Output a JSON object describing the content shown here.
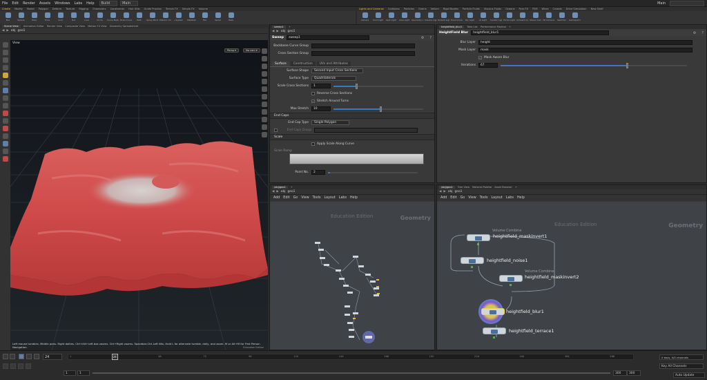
{
  "menubar": {
    "items": [
      "File",
      "Edit",
      "Render",
      "Assets",
      "Windows",
      "Labs",
      "Help"
    ],
    "build": "Build",
    "desktop": "Main",
    "user": "Main"
  },
  "shelf_left": {
    "tabs": [
      "Create",
      "Modify",
      "Model",
      "Polygon",
      "Deform",
      "Texture",
      "Rigging",
      "Characters",
      "Constraints",
      "Hair Utils",
      "Guide Process",
      "Terrain FX",
      "Simple FX",
      "Volume"
    ],
    "tools": [
      "Box",
      "Sphere",
      "Tube",
      "Torus",
      "Grid",
      "Null",
      "Line",
      "Circle",
      "Curve Bezier",
      "Draw Curve",
      "Path",
      "Spray Paint",
      "Platonic Solids",
      "L-System",
      "Metaball",
      "File",
      "Spiral",
      "Helix"
    ]
  },
  "shelf_right": {
    "tabs": [
      "Lights and Cameras",
      "Collisions",
      "Particles",
      "Grains",
      "Vellum",
      "Rigid Bodies",
      "Particle Fluids",
      "Viscous Fluids",
      "Oceans",
      "Pyro FX",
      "FEM",
      "Wires",
      "Crowds",
      "Drive Simulation",
      "New Shelf"
    ],
    "tools": [
      "Camera",
      "Point Light",
      "Spot Light",
      "Area Light",
      "Geometry Light",
      "Volume Light",
      "Distant Light",
      "Environment Light",
      "Sky Light",
      "GI Light",
      "Caustic Light",
      "Portal Light",
      "Ambient Light",
      "Stereo Camera",
      "VR Camera",
      "Switcher",
      "Gamepad Camera"
    ]
  },
  "viewport": {
    "tabs": [
      "Scene View",
      "Animation Editor",
      "Render View",
      "Composite View",
      "Motion FX View",
      "Geometry Spreadsheet"
    ],
    "path": {
      "obj": "obj",
      "node": "geo1"
    },
    "title": "View",
    "persp": "Persp ▾",
    "cam": "No cam ▾",
    "hint": "Left mouse tumbles. Middle pans. Right dollies. Ctrl+Alt+Left box zooms. Ctrl+Right zooms. Spacebar-Ctrl-Left tilts. Hold L for alternate tumble, dolly, and zoom.    M or Alt+M for First Person Navigation.",
    "tag": "Education Edition"
  },
  "params_sweep": {
    "tabs": [
      "sweep1",
      "+"
    ],
    "path": {
      "obj": "obj",
      "node": "geo1"
    },
    "node_type": "Sweep",
    "node_name": "sweep1",
    "backbone_label": "Backbone Curve Group",
    "cross_label": "Cross Section Group",
    "ptabs": [
      "Surface",
      "Construction",
      "UVs and Attributes"
    ],
    "surface_shape_label": "Surface Shape",
    "surface_shape": "Second Input Cross Sections",
    "surface_type_label": "Surface Type",
    "surface_type": "Quadrilaterals",
    "scale_label": "Scale Cross Sections",
    "scale_value": "1",
    "reverse_label": "Reverse Cross Sections",
    "stretch_label": "Stretch Around Turns",
    "max_stretch_label": "Max Stretch",
    "max_stretch_value": "10",
    "end_caps_section": "End Caps",
    "end_cap_type_label": "End Cap Type",
    "end_cap_type": "Single Polygon",
    "end_caps_group_label": "End Caps Group",
    "scale_section": "Scale",
    "apply_scale_label": "Apply Scale Along Curve",
    "scale_ramp_label": "Scale Ramp",
    "point_no_label": "Point No.",
    "point_no_value": "2",
    "position_label": "Position"
  },
  "params_blur": {
    "tabs": [
      "heightfield_blur1",
      "Take List",
      "Performance Monitor",
      "+"
    ],
    "node_type": "HeightField Blur",
    "node_name": "heightfield_blur1",
    "blur_layer_label": "Blur Layer",
    "blur_layer": "height",
    "mask_layer_label": "Mask Layer",
    "mask_layer": "mask",
    "mask_blur_label": "Mask Aware Blur",
    "iterations_label": "Iterations",
    "iterations_value": "67"
  },
  "net_left": {
    "tabs": [
      "/obj/geo1",
      "+"
    ],
    "path": {
      "obj": "obj",
      "node": "geo1"
    },
    "menu": [
      "Add",
      "Edit",
      "Go",
      "View",
      "Tools",
      "Layout",
      "Labs",
      "Help"
    ],
    "edition": "Education Edition",
    "context": "Geometry"
  },
  "net_right": {
    "tabs": [
      "/obj/geo1",
      "Tree View",
      "Material Palette",
      "Asset Browser",
      "+"
    ],
    "path": {
      "obj": "obj",
      "node": "geo1"
    },
    "menu": [
      "Add",
      "Edit",
      "Go",
      "View",
      "Tools",
      "Layout",
      "Labs",
      "Help"
    ],
    "edition": "Education Edition",
    "context": "Geometry",
    "nodes": [
      {
        "name": "heightfield_maskinvert1",
        "sub": "Volume Combine"
      },
      {
        "name": "heightfield_noise1",
        "sub": ""
      },
      {
        "name": "heightfield_maskinvert2",
        "sub": "Volume Combine"
      },
      {
        "name": "heightfield_blur1",
        "sub": ""
      },
      {
        "name": "heightfield_terrace1",
        "sub": ""
      }
    ]
  },
  "timeline": {
    "frame": "24",
    "current": "24",
    "start": "1",
    "start2": "1",
    "end": "300",
    "end2": "300",
    "ticks": [
      "1",
      "24",
      "48",
      "72",
      "96",
      "120",
      "144",
      "168",
      "192",
      "216",
      "240",
      "264",
      "288"
    ],
    "keys": "0 keys, 0/0 channels",
    "key_all": "Key All Channels",
    "auto_update": "Auto Update"
  }
}
